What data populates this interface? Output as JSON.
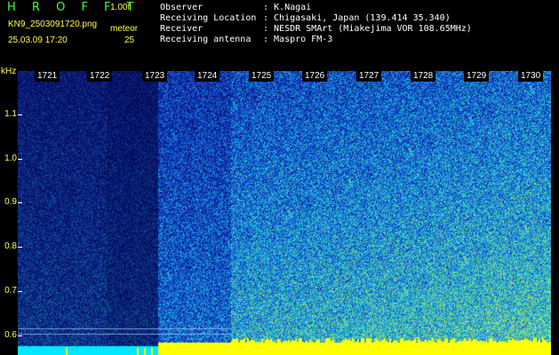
{
  "header": {
    "app_name": "H R O F F T",
    "version": "1.00f",
    "file_name": "KN9_2503091720.png",
    "datetime": "25.03.09 17:20",
    "meteor_label": "meteor",
    "meteor_count": "25"
  },
  "info": [
    {
      "key": "Observer",
      "value": ": K.Nagai"
    },
    {
      "key": "Receiving Location",
      "value": ": Chigasaki, Japan (139.414 35.340)"
    },
    {
      "key": "Receiver",
      "value": ": NESDR SMArt (Miakejima VOR 108.65MHz)"
    },
    {
      "key": "Receiving antenna",
      "value": ": Maspro FM-3"
    }
  ],
  "y_axis": {
    "unit": "kHz",
    "ticks": [
      "1.1",
      "1.0",
      "0.9",
      "0.8",
      "0.7",
      "0.6"
    ]
  },
  "x_axis": {
    "ticks": [
      "1721",
      "1722",
      "1723",
      "1724",
      "1725",
      "1726",
      "1727",
      "1728",
      "1729",
      "1730"
    ]
  },
  "colors": {
    "background": "#000000",
    "title": "#39ff39",
    "label": "#ffff40",
    "noise_low": "#0a1a8c",
    "noise_high": "#20c8d0",
    "bottom_band_left": "#00e8ff",
    "bottom_band_right": "#ffff00"
  }
}
